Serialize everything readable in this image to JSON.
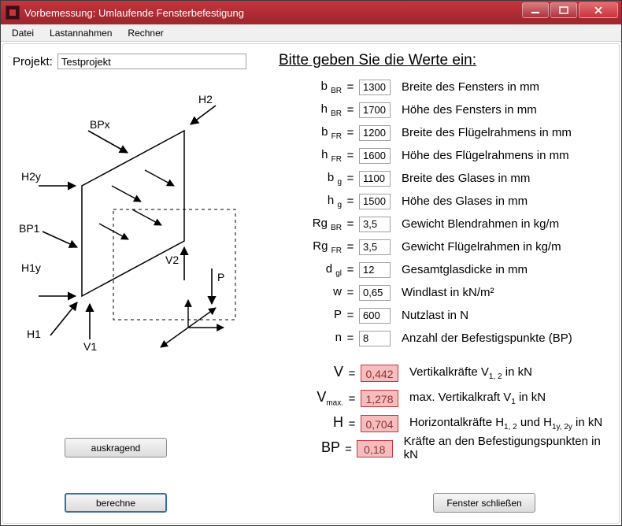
{
  "window": {
    "title": "Vorbemessung: Umlaufende Fensterbefestigung"
  },
  "menu": {
    "file": "Datei",
    "loads": "Lastannahmen",
    "calc": "Rechner"
  },
  "projekt": {
    "label": "Projekt:",
    "value": "Testprojekt"
  },
  "diagram_labels": {
    "BPx": "BPx",
    "BP1": "BP1",
    "H2": "H2",
    "H2y": "H2y",
    "H1y": "H1y",
    "H1": "H1",
    "V1": "V1",
    "V2": "V2",
    "P": "P"
  },
  "prompt": "Bitte geben Sie die Werte ein:",
  "inputs": [
    {
      "sym_main": "b",
      "sym_sub": "BR",
      "value": "1300",
      "desc": "Breite des Fensters in mm"
    },
    {
      "sym_main": "h",
      "sym_sub": "BR",
      "value": "1700",
      "desc": "Höhe des Fensters in mm"
    },
    {
      "sym_main": "b",
      "sym_sub": "FR",
      "value": "1200",
      "desc": "Breite des Flügelrahmens in mm"
    },
    {
      "sym_main": "h",
      "sym_sub": "FR",
      "value": "1600",
      "desc": "Höhe des Flügelrahmens in mm"
    },
    {
      "sym_main": "b",
      "sym_sub": "g",
      "value": "1100",
      "desc": "Breite des Glases in mm"
    },
    {
      "sym_main": "h",
      "sym_sub": "g",
      "value": "1500",
      "desc": "Höhe des Glases in mm"
    },
    {
      "sym_main": "Rg",
      "sym_sub": "BR",
      "value": "3,5",
      "desc": "Gewicht Blendrahmen in kg/m"
    },
    {
      "sym_main": "Rg",
      "sym_sub": "FR",
      "value": "3,5",
      "desc": "Gewicht Flügelrahmen in kg/m"
    },
    {
      "sym_main": "d",
      "sym_sub": "gl",
      "value": "12",
      "desc": "Gesamtglasdicke in mm"
    },
    {
      "sym_main": "w",
      "sym_sub": "",
      "value": "0,65",
      "desc": "Windlast in kN/m²"
    },
    {
      "sym_main": "P",
      "sym_sub": "",
      "value": "600",
      "desc": "Nutzlast in N"
    },
    {
      "sym_main": "n",
      "sym_sub": "",
      "value": "8",
      "desc": "Anzahl der Befestigspunkte (BP)"
    }
  ],
  "results": [
    {
      "sym_main": "V",
      "sym_sub": "",
      "value": "0,442",
      "desc": "Vertikalkräfte V",
      "desc_sub": "1, 2",
      "desc_tail": " in kN"
    },
    {
      "sym_main": "V",
      "sym_sub": "max.",
      "value": "1,278",
      "desc": "max. Vertikalkraft V",
      "desc_sub": "1",
      "desc_tail": " in kN"
    },
    {
      "sym_main": "H",
      "sym_sub": "",
      "value": "0,704",
      "desc": "Horizontalkräfte H",
      "desc_sub": "1, 2",
      "desc_tail": " und H",
      "desc_sub2": "1y, 2y",
      "desc_tail2": " in kN"
    },
    {
      "sym_main": "BP",
      "sym_sub": "",
      "value": "0,18",
      "desc": "Kräfte an den Befestigungspunkten in kN",
      "desc_sub": "",
      "desc_tail": ""
    }
  ],
  "buttons": {
    "auskragend": "auskragend",
    "berechne": "berechne",
    "schliessen": "Fenster schließen"
  }
}
